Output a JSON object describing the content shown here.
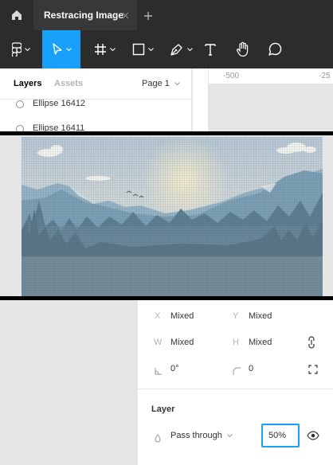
{
  "titlebar": {
    "tab_title": "Restracing Image"
  },
  "layers_panel": {
    "tabs": {
      "layers": "Layers",
      "assets": "Assets",
      "page": "Page 1"
    },
    "items": [
      {
        "label": "Ellipse 16412"
      },
      {
        "label": "Ellipse 16411"
      }
    ]
  },
  "ruler": {
    "labels": [
      "-500",
      "-25"
    ]
  },
  "properties": {
    "x_label": "X",
    "x_value": "Mixed",
    "y_label": "Y",
    "y_value": "Mixed",
    "w_label": "W",
    "w_value": "Mixed",
    "h_label": "H",
    "h_value": "Mixed",
    "rotation_value": "0°",
    "radius_value": "0",
    "layer_section": "Layer",
    "blend_mode": "Pass through",
    "opacity": "50%"
  },
  "colors": {
    "accent": "#18a0fb",
    "toolbar_bg": "#2c2c2c",
    "panel_bg": "#ffffff",
    "canvas_bg": "#e5e5e5"
  }
}
